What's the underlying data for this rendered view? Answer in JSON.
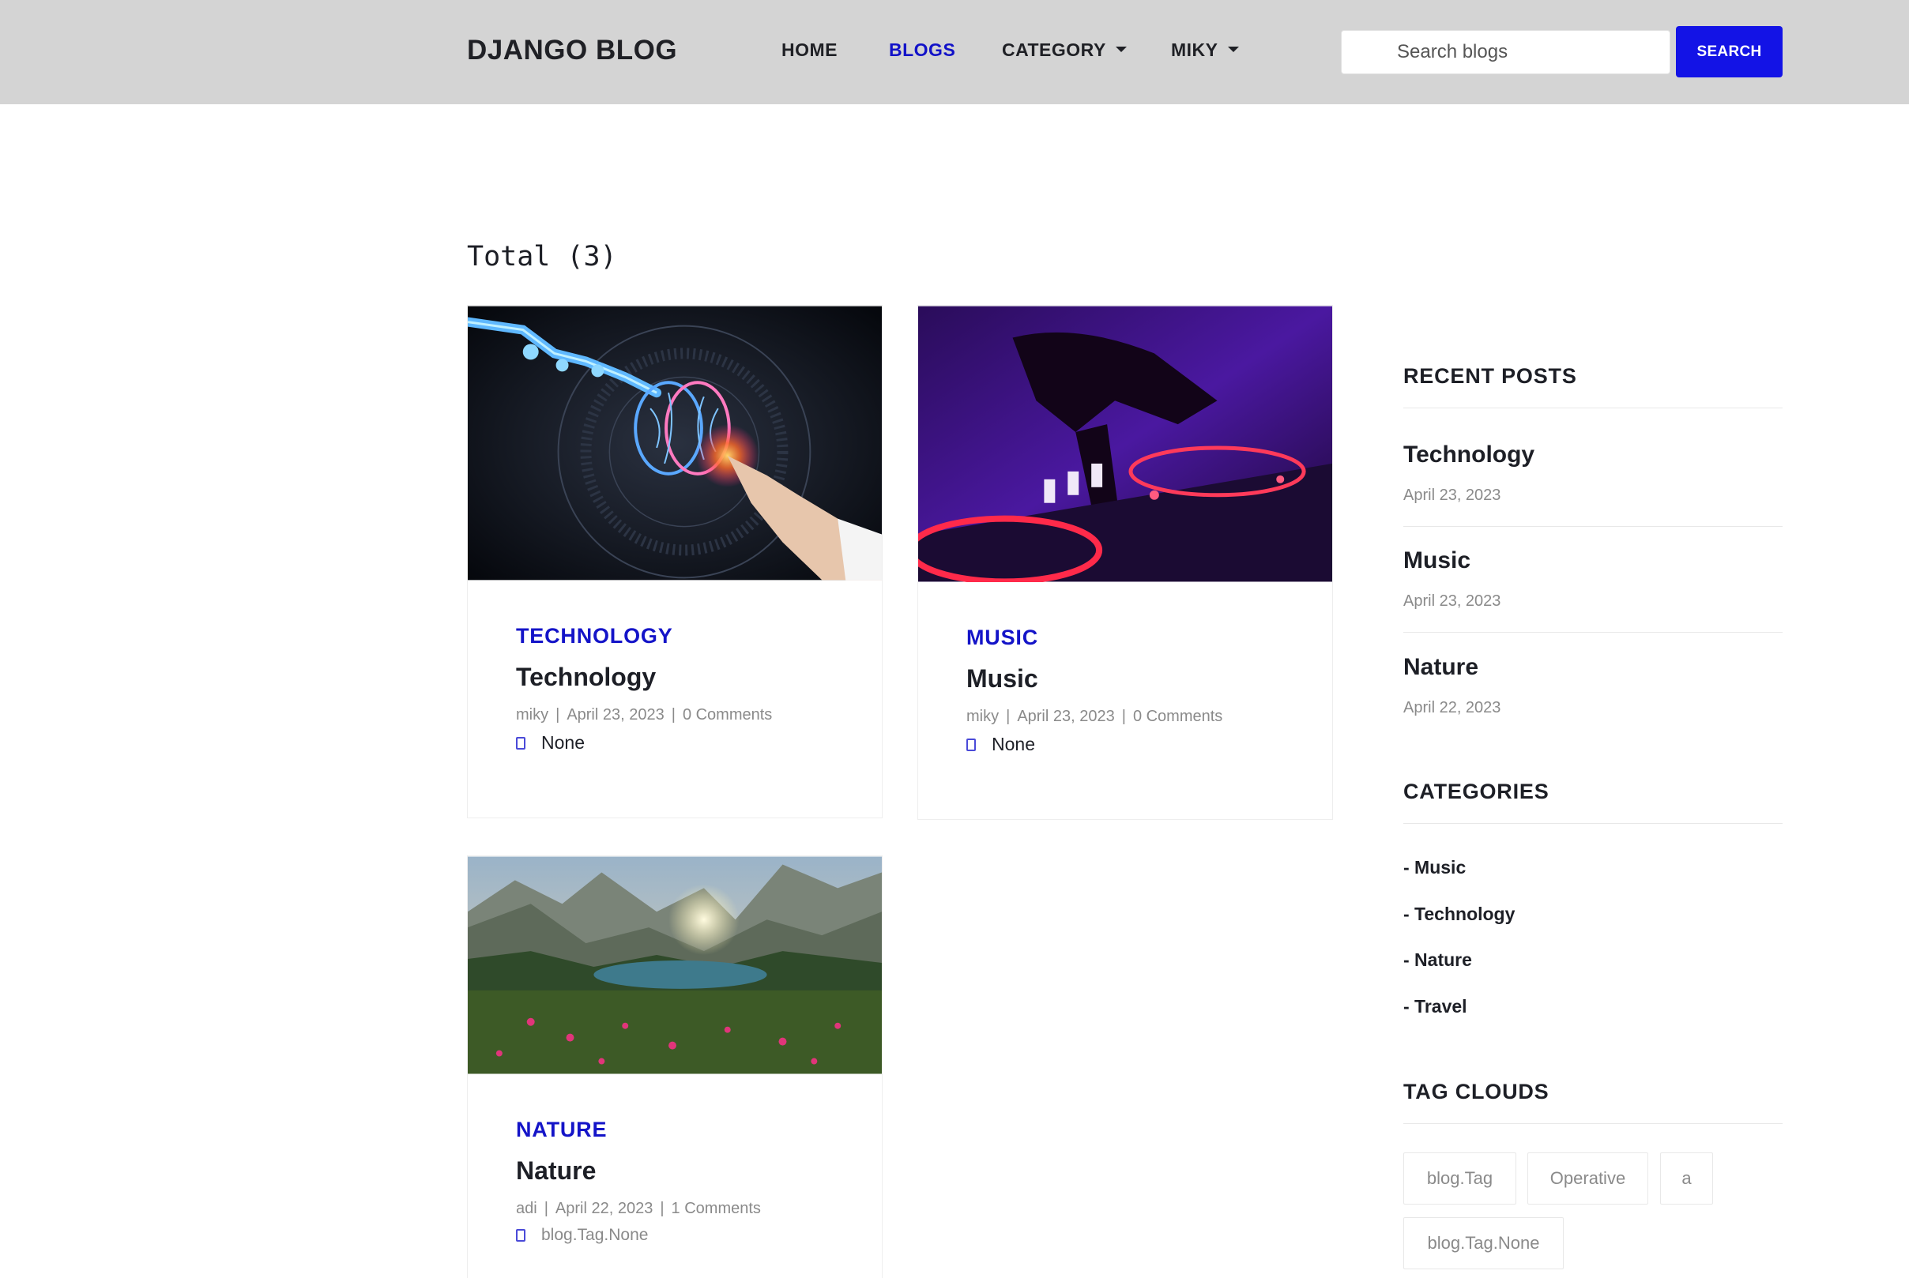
{
  "header": {
    "brand": "DJANGO BLOG",
    "nav": [
      {
        "label": "HOME"
      },
      {
        "label": "BLOGS"
      },
      {
        "label": "CATEGORY"
      },
      {
        "label": "MIKY"
      }
    ],
    "search_placeholder": "Search blogs",
    "search_button": "SEARCH",
    "accent_color": "#1313e6"
  },
  "main": {
    "total_label": "Total (3)",
    "posts": [
      {
        "category": "TECHNOLOGY",
        "title": "Technology",
        "author": "miky",
        "date": "April 23, 2023",
        "comments": "0 Comments",
        "tags": "None",
        "image": "brain-touch-image"
      },
      {
        "category": "MUSIC",
        "title": "Music",
        "author": "miky",
        "date": "April 23, 2023",
        "comments": "0 Comments",
        "tags": "None",
        "image": "dj-turntable-image"
      },
      {
        "category": "NATURE",
        "title": "Nature",
        "author": "adi",
        "date": "April 22, 2023",
        "comments": "1 Comments",
        "tags": "blog.Tag.None",
        "image": "mountain-lake-image"
      }
    ]
  },
  "sidebar": {
    "recent_heading": "RECENT POSTS",
    "recent": [
      {
        "title": "Technology",
        "date": "April 23, 2023"
      },
      {
        "title": "Music",
        "date": "April 23, 2023"
      },
      {
        "title": "Nature",
        "date": "April 22, 2023"
      }
    ],
    "categories_heading": "CATEGORIES",
    "categories": [
      "- Music",
      "- Technology",
      "- Nature",
      "- Travel"
    ],
    "tags_heading": "TAG CLOUDS",
    "tags": [
      "blog.Tag",
      "Operative",
      "a",
      "blog.Tag.None"
    ]
  }
}
